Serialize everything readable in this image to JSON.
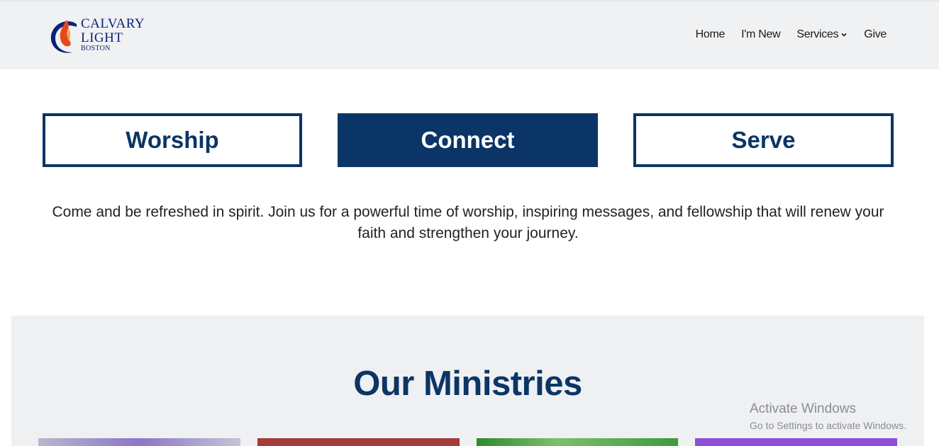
{
  "brand": {
    "line1": "CALVARY",
    "line2": "LIGHT",
    "line3": "BOSTON",
    "colors": {
      "navy": "#0d2277",
      "flame": "#e8471c"
    }
  },
  "nav": {
    "items": [
      "Home",
      "I'm New",
      "Services",
      "Give"
    ]
  },
  "tabs": [
    {
      "label": "Worship",
      "active": false
    },
    {
      "label": "Connect",
      "active": true
    },
    {
      "label": "Serve",
      "active": false
    }
  ],
  "description": "Come and be refreshed in spirit. Join us for a powerful time of worship, inspiring messages, and fellowship that will renew your faith and strengthen your journey.",
  "ministries": {
    "title": "Our Ministries"
  },
  "watermark": {
    "line1": "Activate Windows",
    "line2": "Go to Settings to activate Windows."
  },
  "colors": {
    "accent": "#0b3566",
    "header_bg": "#f0f1f3",
    "section_bg": "#eff0f2"
  }
}
